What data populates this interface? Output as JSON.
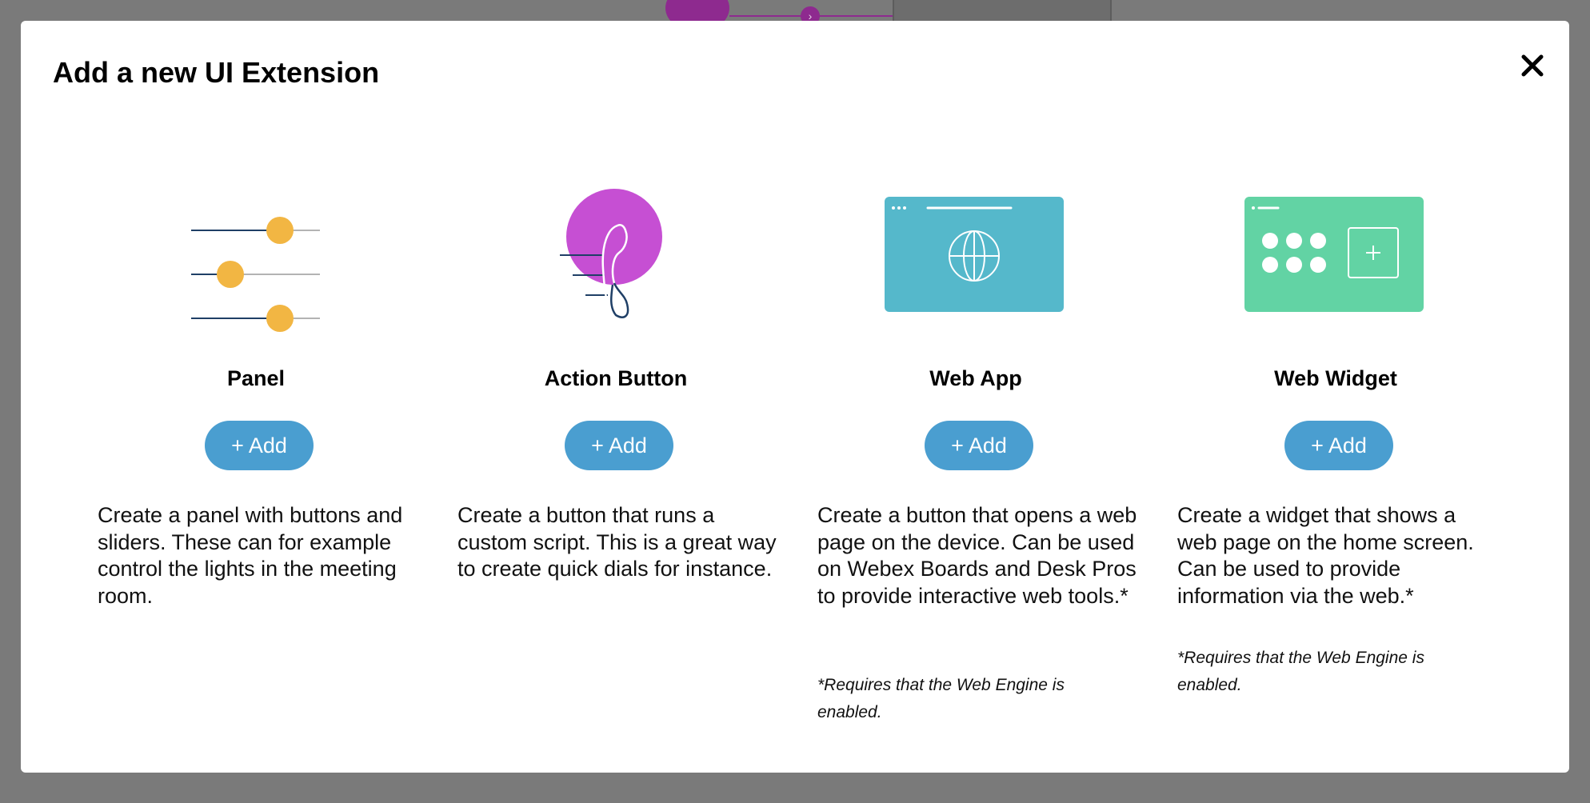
{
  "modal": {
    "title": "Add a new UI Extension",
    "close_label": "✕"
  },
  "cards": [
    {
      "title": "Panel",
      "add_label": "+ Add",
      "description": "Create a panel with buttons and sliders. These can for example control the lights in the meeting room.",
      "note": "",
      "icon": "sliders-icon"
    },
    {
      "title": "Action Button",
      "add_label": "+ Add",
      "description": "Create a button that runs a custom script. This is a great way to create quick dials for instance.",
      "note": "",
      "icon": "phone-icon"
    },
    {
      "title": "Web App",
      "add_label": "+ Add",
      "description": "Create a button that opens a web page on the device. Can be used on Webex Boards and Desk Pros to provide interactive web tools.*",
      "note": "*Requires that the Web Engine is enabled.",
      "icon": "globe-browser-icon"
    },
    {
      "title": "Web Widget",
      "add_label": "+ Add",
      "description": "Create a widget that shows a web page on the home screen. Can be used to provide information via the web.*",
      "note": "*Requires that the Web Engine is enabled.",
      "icon": "widget-grid-icon"
    }
  ],
  "colors": {
    "accent_button": "#4a9ed0",
    "slider_knob": "#f2b643",
    "action_circle": "#c64fd3",
    "web_app_tile": "#55b8cb",
    "web_widget_tile": "#62d3a4"
  }
}
